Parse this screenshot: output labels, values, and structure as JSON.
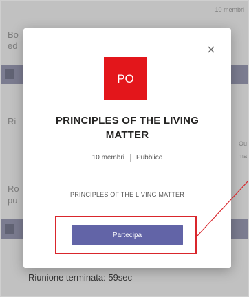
{
  "background": {
    "top_right_text": "10 membri",
    "left_fragments": [
      "Bo",
      "ed",
      "Ri",
      "Ro",
      "pu"
    ],
    "right_fragments": [
      "Ou",
      "ma"
    ],
    "footer_status": "Riunione terminata: 59sec"
  },
  "modal": {
    "close_icon": "close-icon",
    "avatar_initials": "PO",
    "avatar_color": "#e3161b",
    "team_name": "PRINCIPLES OF THE LIVING MATTER",
    "member_count": "10 membri",
    "visibility": "Pubblico",
    "description": "PRINCIPLES OF THE LIVING MATTER",
    "join_label": "Partecipa",
    "join_color": "#6264a7"
  },
  "annotation": {
    "highlight_color": "#d9262c"
  }
}
